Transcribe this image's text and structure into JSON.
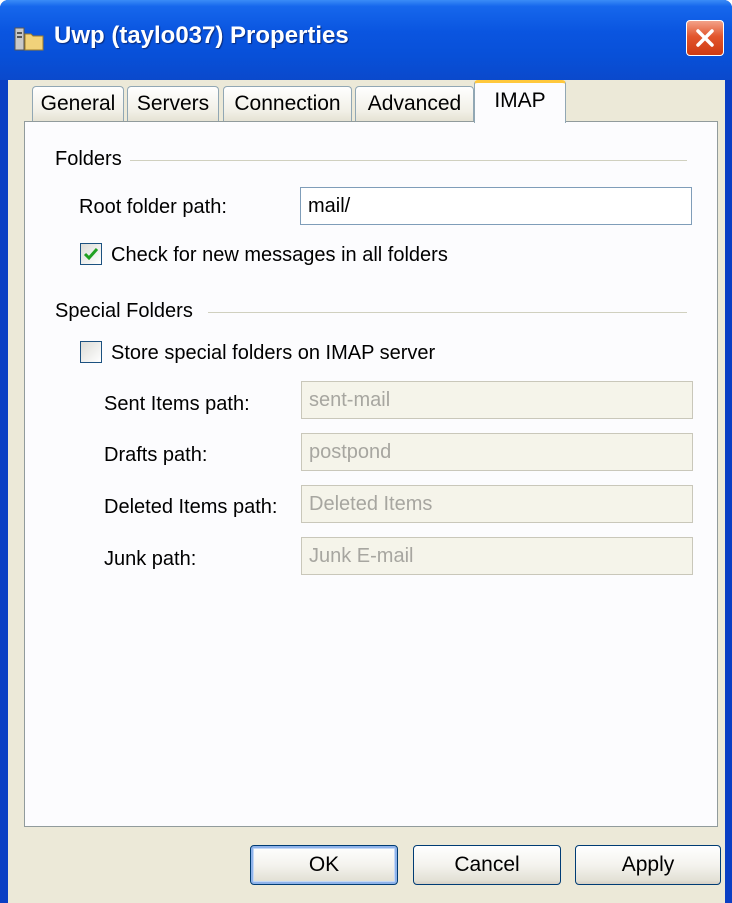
{
  "window": {
    "title": "Uwp (taylo037) Properties",
    "icon": "server-folder-icon",
    "close_icon": "close-icon"
  },
  "tabs": [
    {
      "label": "General",
      "active": false
    },
    {
      "label": "Servers",
      "active": false
    },
    {
      "label": "Connection",
      "active": false
    },
    {
      "label": "Advanced",
      "active": false
    },
    {
      "label": "IMAP",
      "active": true
    }
  ],
  "folders": {
    "group_label": "Folders",
    "root_label": "Root folder path:",
    "root_value": "mail/",
    "check_new_label": "Check for new messages in all folders",
    "check_new_checked": true
  },
  "special": {
    "group_label": "Special Folders",
    "store_label": "Store special folders on IMAP server",
    "store_checked": false,
    "sent_label": "Sent Items path:",
    "sent_value": "sent-mail",
    "drafts_label": "Drafts path:",
    "drafts_value": "postpond",
    "deleted_label": "Deleted Items path:",
    "deleted_value": "Deleted Items",
    "junk_label": "Junk path:",
    "junk_value": "Junk E-mail"
  },
  "buttons": {
    "ok": "OK",
    "cancel": "Cancel",
    "apply": "Apply"
  },
  "colors": {
    "titlebar": "#0a55e0",
    "close": "#e2562d",
    "active_tab_accent": "#ffc83c",
    "checkmark": "#21a121"
  }
}
